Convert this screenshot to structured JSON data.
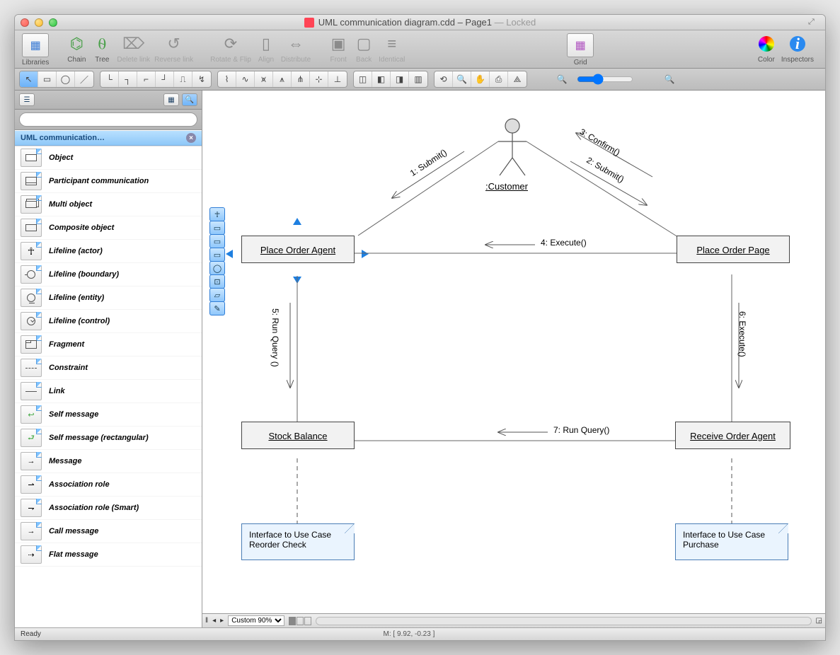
{
  "window": {
    "filename": "UML communication diagram.cdd",
    "page": "Page1",
    "locked": "Locked"
  },
  "main_toolbar": {
    "libraries": "Libraries",
    "chain": "Chain",
    "tree": "Tree",
    "delete_link": "Delete link",
    "reverse_link": "Reverse link",
    "rotate_flip": "Rotate & Flip",
    "align": "Align",
    "distribute": "Distribute",
    "front": "Front",
    "back": "Back",
    "identical": "Identical",
    "grid": "Grid",
    "color": "Color",
    "inspectors": "Inspectors"
  },
  "sidebar": {
    "library_title": "UML communication…",
    "search_placeholder": "",
    "shapes": [
      "Object",
      "Participant communication",
      "Multi object",
      "Composite object",
      "Lifeline (actor)",
      "Lifeline (boundary)",
      "Lifeline (entity)",
      "Lifeline (control)",
      "Fragment",
      "Constraint",
      "Link",
      "Self message",
      "Self message (rectangular)",
      "Message",
      "Association role",
      "Association role (Smart)",
      "Call message",
      "Flat message"
    ]
  },
  "diagram": {
    "actor": ":Customer",
    "nodes": {
      "place_order_agent": "Place Order Agent",
      "place_order_page": "Place Order Page",
      "stock_balance": "Stock Balance",
      "receive_order_agent": "Receive Order Agent"
    },
    "notes": {
      "reorder": "Interface to Use Case Reorder Check",
      "purchase": "Interface to Use Case Purchase"
    },
    "messages": {
      "m1": "1: Submit()",
      "m2": "2: Submit()",
      "m3": "3: Confirm()",
      "m4": "4: Execute()",
      "m5": "5: Run Query ()",
      "m6": "6: Execute()",
      "m7": "7: Run Query()"
    }
  },
  "bottom": {
    "zoom": "Custom 90%",
    "status_left": "Ready",
    "status_mid": "M: [ 9.92, -0.23 ]"
  }
}
